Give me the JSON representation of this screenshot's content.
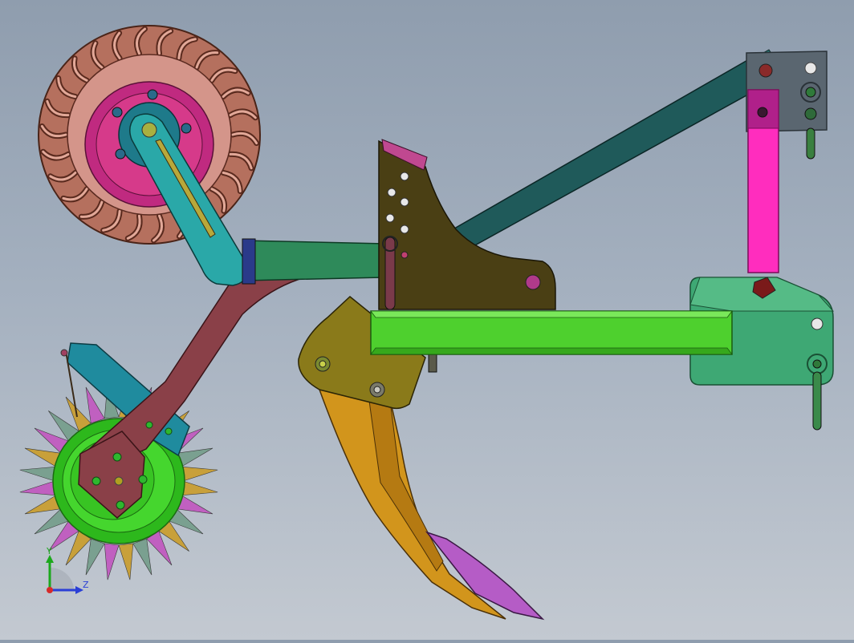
{
  "viewport": {
    "background_top": "#8f9dae",
    "background_bottom": "#c3c9d1"
  },
  "model": {
    "parts": [
      {
        "name": "gauge-wheel-tire",
        "color": "#c88a7a"
      },
      {
        "name": "gauge-wheel-hub",
        "color": "#d63a8a"
      },
      {
        "name": "wheel-arm",
        "color": "#2aa8a8"
      },
      {
        "name": "top-link",
        "color": "#1f5a5a"
      },
      {
        "name": "main-frame-beam",
        "color": "#4ed02e"
      },
      {
        "name": "curved-shank-arm",
        "color": "#8a4048"
      },
      {
        "name": "mounting-plate",
        "color": "#4a3f14"
      },
      {
        "name": "subsoiler-shank",
        "color": "#d2951c"
      },
      {
        "name": "shank-point",
        "color": "#b55cc6"
      },
      {
        "name": "packer-roller",
        "color": "#35c51f"
      },
      {
        "name": "roller-bracket",
        "color": "#1f8b9e"
      },
      {
        "name": "hitch-post",
        "color": "#ff2dbe"
      },
      {
        "name": "hitch-plate-rear",
        "color": "#3ea874"
      },
      {
        "name": "hitch-plate-top",
        "color": "#5a6670"
      }
    ]
  },
  "triad": {
    "y_label": "Y",
    "z_label": "Z",
    "y_color": "#1ca81c",
    "z_color": "#2a3fd6",
    "x_color": "#d62a2a"
  }
}
